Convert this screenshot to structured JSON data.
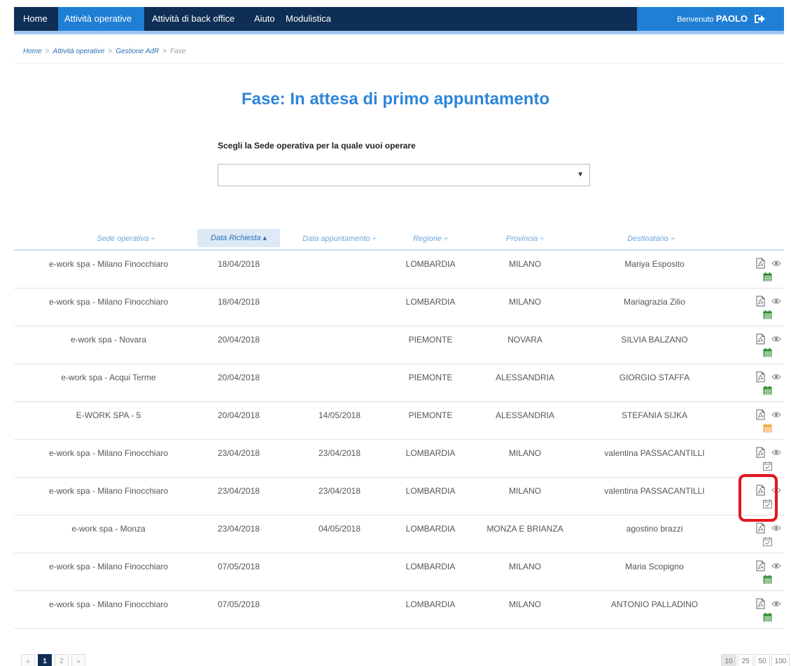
{
  "nav": {
    "items": [
      "Home",
      "Attività operative",
      "Attività di back office",
      "Aiuto",
      "Modulistica"
    ],
    "welcome": "Benvenuto",
    "user": "PAOLO"
  },
  "breadcrumb": [
    "Home",
    "Attività operative",
    "Gestione AdR",
    "Fase"
  ],
  "title": "Fase: In attesa di primo appuntamento",
  "select": {
    "label": "Scegli la Sede operativa per la quale vuoi operare",
    "value": ""
  },
  "table": {
    "columns": [
      "Sede operativa ÷",
      "Data Richiesta ▴",
      "Data appuntamento ÷",
      "Regione ÷",
      "Provincia ÷",
      "Destinatario ÷"
    ],
    "sorted_column": 1,
    "rows": [
      {
        "sede": "e-work spa - Milano Finocchiaro",
        "data_richiesta": "18/04/2018",
        "data_appuntamento": "",
        "regione": "LOMBARDIA",
        "provincia": "MILANO",
        "destinatario": "Mariya Esposito",
        "calendar": "green"
      },
      {
        "sede": "e-work spa - Milano Finocchiaro",
        "data_richiesta": "18/04/2018",
        "data_appuntamento": "",
        "regione": "LOMBARDIA",
        "provincia": "MILANO",
        "destinatario": "Mariagrazia Zilio",
        "calendar": "green"
      },
      {
        "sede": "e-work spa - Novara",
        "data_richiesta": "20/04/2018",
        "data_appuntamento": "",
        "regione": "PIEMONTE",
        "provincia": "NOVARA",
        "destinatario": "SILVIA BALZANO",
        "calendar": "green"
      },
      {
        "sede": "e-work spa - Acqui Terme",
        "data_richiesta": "20/04/2018",
        "data_appuntamento": "",
        "regione": "PIEMONTE",
        "provincia": "ALESSANDRIA",
        "destinatario": "GIORGIO STAFFA",
        "calendar": "green"
      },
      {
        "sede": "E-WORK SPA - 5",
        "data_richiesta": "20/04/2018",
        "data_appuntamento": "14/05/2018",
        "regione": "PIEMONTE",
        "provincia": "ALESSANDRIA",
        "destinatario": "STEFANIA SIJKA",
        "calendar": "orange"
      },
      {
        "sede": "e-work spa - Milano Finocchiaro",
        "data_richiesta": "23/04/2018",
        "data_appuntamento": "23/04/2018",
        "regione": "LOMBARDIA",
        "provincia": "MILANO",
        "destinatario": "valentina PASSACANTILLI",
        "calendar": "check"
      },
      {
        "sede": "e-work spa - Milano Finocchiaro",
        "data_richiesta": "23/04/2018",
        "data_appuntamento": "23/04/2018",
        "regione": "LOMBARDIA",
        "provincia": "MILANO",
        "destinatario": "valentina PASSACANTILLI",
        "calendar": "check"
      },
      {
        "sede": "e-work spa - Monza",
        "data_richiesta": "23/04/2018",
        "data_appuntamento": "04/05/2018",
        "regione": "LOMBARDIA",
        "provincia": "MONZA E BRIANZA",
        "destinatario": "agostino brazzi",
        "calendar": "check"
      },
      {
        "sede": "e-work spa - Milano Finocchiaro",
        "data_richiesta": "07/05/2018",
        "data_appuntamento": "",
        "regione": "LOMBARDIA",
        "provincia": "MILANO",
        "destinatario": "Maria Scopigno",
        "calendar": "green"
      },
      {
        "sede": "e-work spa - Milano Finocchiaro",
        "data_richiesta": "07/05/2018",
        "data_appuntamento": "",
        "regione": "LOMBARDIA",
        "provincia": "MILANO",
        "destinatario": "ANTONIO PALLADINO",
        "calendar": "green"
      }
    ]
  },
  "pagination": {
    "prev": "«",
    "pages": [
      "1",
      "2"
    ],
    "current": "1",
    "next": "»",
    "page_sizes": [
      "10",
      "25",
      "50",
      "100"
    ],
    "selected_page_size": "10"
  },
  "colors": {
    "nav_bg": "#0f2e55",
    "accent": "#1f7fd4",
    "title": "#2e86d8",
    "calendar_green": "#2e8b2e",
    "calendar_orange": "#f0a030",
    "calendar_check": "#888888",
    "highlight": "#e5141c"
  }
}
